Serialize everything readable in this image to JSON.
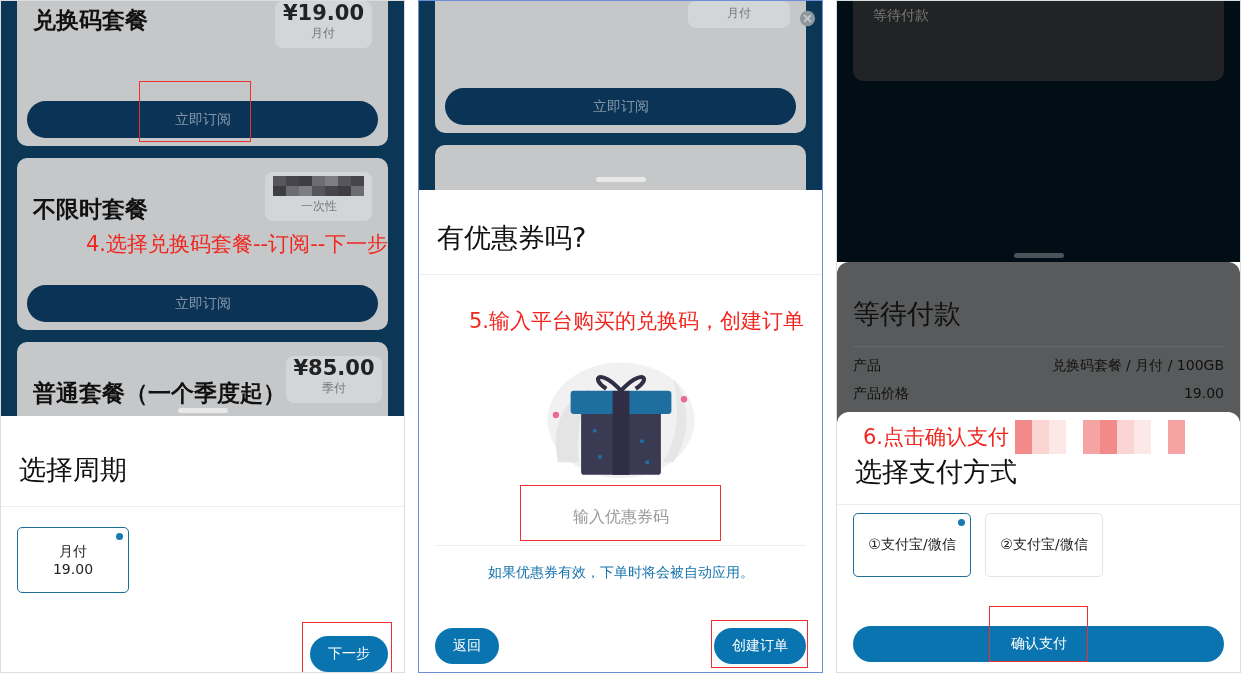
{
  "cycle_screen": {
    "plans": [
      {
        "name": "兑换码套餐",
        "price": "¥19.00",
        "price_redacted": false,
        "period": "月付",
        "button": "立即订阅",
        "highlighted": true
      },
      {
        "name": "不限时套餐",
        "price_redacted": true,
        "period": "一次性",
        "button": "立即订阅",
        "highlighted": false
      },
      {
        "name": "普通套餐（一个季度起）",
        "price": "¥85.00",
        "price_redacted": false,
        "period": "季付"
      }
    ],
    "annotation": "4.选择兑换码套餐--订阅--下一步",
    "sheet": {
      "title": "选择周期",
      "options": [
        {
          "label": "月付",
          "value": "19.00",
          "selected": true
        }
      ],
      "next_button": {
        "label": "下一步",
        "highlighted": true
      }
    }
  },
  "coupon_screen": {
    "background": {
      "period": "月付",
      "button": "立即订阅"
    },
    "annotation": "5.输入平台购买的兑换码，创建订单",
    "sheet": {
      "title": "有优惠券吗?",
      "coupon_field": {
        "placeholder": "输入优惠券码",
        "highlighted": true
      },
      "note": "如果优惠券有效，下单时将会被自动应用。",
      "back_button": {
        "label": "返回"
      },
      "create_button": {
        "label": "创建订单",
        "highlighted": true
      }
    }
  },
  "payment_screen": {
    "background": {
      "status": "等待付款"
    },
    "order_sheet": {
      "title": "等待付款",
      "rows": [
        {
          "label": "产品",
          "value": "兑换码套餐 / 月付 / 100GB"
        },
        {
          "label": "产品价格",
          "value": "19.00"
        }
      ]
    },
    "annotation": "6.点击确认支付",
    "sheet": {
      "title": "选择支付方式",
      "methods": [
        {
          "label": "①支付宝/微信",
          "selected": true
        },
        {
          "label": "②支付宝/微信",
          "selected": false
        }
      ],
      "confirm_button": {
        "label": "确认支付",
        "highlighted": true
      }
    }
  }
}
